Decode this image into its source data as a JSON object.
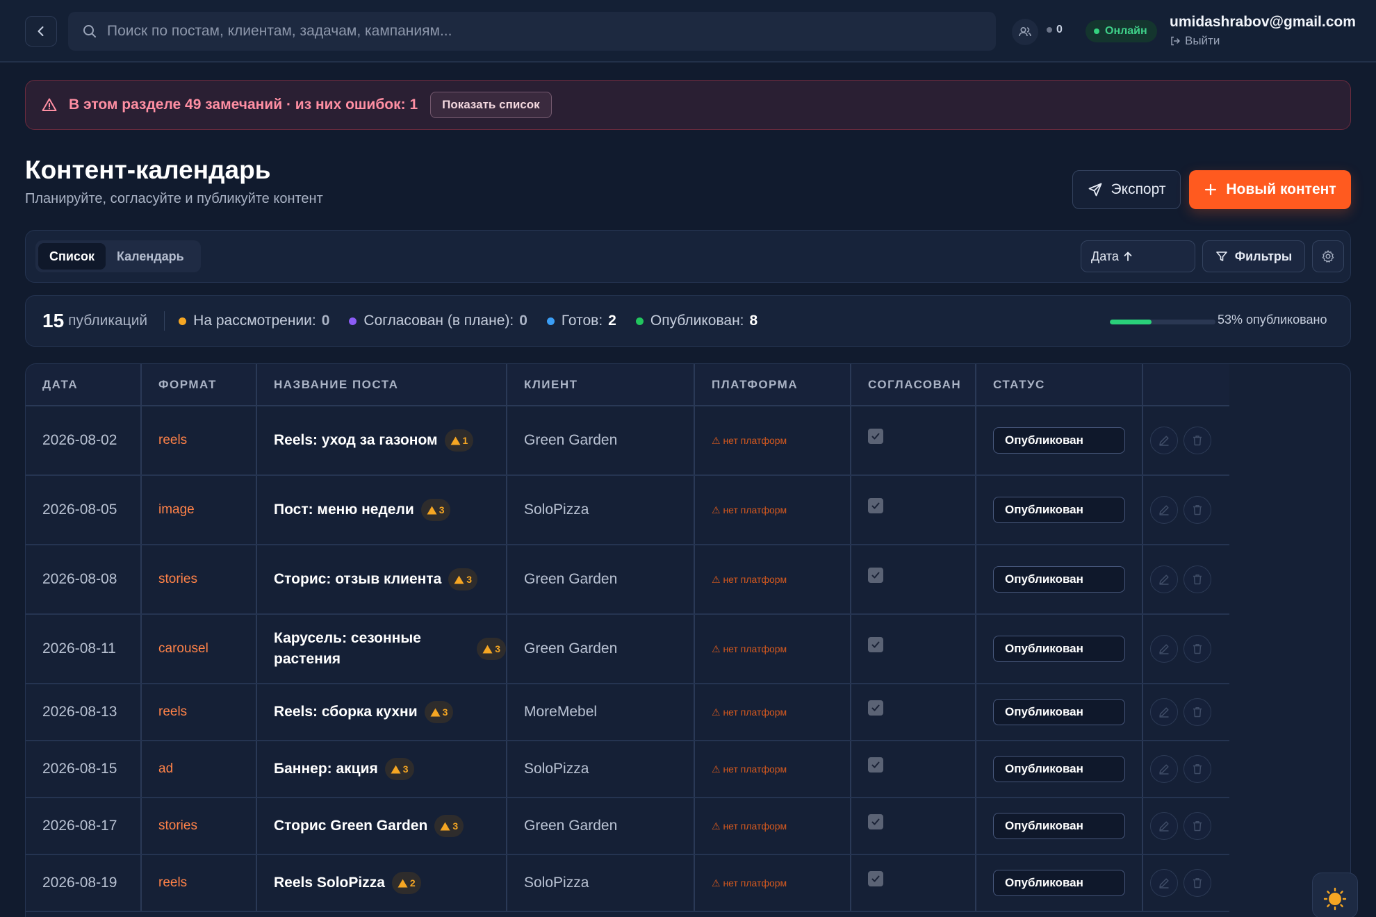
{
  "header": {
    "search_placeholder": "Поиск по постам, клиентам, задачам, кампаниям...",
    "online_users_count": "0",
    "online_label": "Онлайн",
    "user_email": "umidashrabov@gmail.com",
    "logout_label": "Выйти"
  },
  "alert": {
    "text": "В этом разделе 49 замечаний · из них ошибок: 1",
    "button_label": "Показать список"
  },
  "page": {
    "title": "Контент-календарь",
    "subtitle": "Планируйте, согласуйте и публикуйте контент",
    "export_label": "Экспорт",
    "new_content_label": "Новый контент"
  },
  "toolbar": {
    "tab_list": "Список",
    "tab_calendar": "Календарь",
    "sort_label": "Дата",
    "filters_label": "Фильтры"
  },
  "stats": {
    "total": "15",
    "total_label": "публикаций",
    "items": [
      {
        "label": "На рассмотрении:",
        "value": "0",
        "color": "#f5a623"
      },
      {
        "label": "Согласован (в плане):",
        "value": "0",
        "color": "#8b5cf6"
      },
      {
        "label": "Готов:",
        "value": "2",
        "color": "#3b9ef5"
      },
      {
        "label": "Опубликован:",
        "value": "8",
        "color": "#22c55e"
      }
    ],
    "published_percent": 53,
    "published_label": "53% опубликовано"
  },
  "table": {
    "headers": [
      "ДАТА",
      "ФОРМАТ",
      "НАЗВАНИЕ ПОСТА",
      "КЛИЕНТ",
      "ПЛАТФОРМА",
      "СОГЛАСОВАН",
      "СТАТУС",
      ""
    ],
    "rows": [
      {
        "date": "2026-08-02",
        "format": "reels",
        "title": "Reels: уход за газоном",
        "warnings": "1",
        "client": "Green Garden",
        "platform": "нет платформ",
        "approved": true,
        "status": "Опубликован"
      },
      {
        "date": "2026-08-05",
        "format": "image",
        "title": "Пост: меню недели",
        "warnings": "3",
        "client": "SoloPizza",
        "platform": "нет платформ",
        "approved": true,
        "status": "Опубликован"
      },
      {
        "date": "2026-08-08",
        "format": "stories",
        "title": "Сторис: отзыв клиента",
        "warnings": "3",
        "client": "Green Garden",
        "platform": "нет платформ",
        "approved": true,
        "status": "Опубликован"
      },
      {
        "date": "2026-08-11",
        "format": "carousel",
        "title": "Карусель: сезонные растения",
        "warnings": "3",
        "client": "Green Garden",
        "platform": "нет платформ",
        "approved": true,
        "status": "Опубликован"
      },
      {
        "date": "2026-08-13",
        "format": "reels",
        "title": "Reels: сборка кухни",
        "warnings": "3",
        "client": "MoreMebel",
        "platform": "нет платформ",
        "approved": true,
        "status": "Опубликован"
      },
      {
        "date": "2026-08-15",
        "format": "ad",
        "title": "Баннер: акция",
        "warnings": "3",
        "client": "SoloPizza",
        "platform": "нет платформ",
        "approved": true,
        "status": "Опубликован"
      },
      {
        "date": "2026-08-17",
        "format": "stories",
        "title": "Сторис Green Garden",
        "warnings": "3",
        "client": "Green Garden",
        "platform": "нет платформ",
        "approved": true,
        "status": "Опубликован"
      },
      {
        "date": "2026-08-19",
        "format": "reels",
        "title": "Reels SoloPizza",
        "warnings": "2",
        "client": "SoloPizza",
        "platform": "нет платформ",
        "approved": true,
        "status": "Опубликован"
      }
    ]
  },
  "icons": {
    "back": "chevron-left-icon",
    "search": "search-icon",
    "users": "users-icon",
    "logout": "logout-icon",
    "alert": "warning-triangle-icon",
    "export": "send-icon",
    "plus": "plus-icon",
    "sort": "arrow-up-icon",
    "filter": "filter-icon",
    "settings": "gear-icon",
    "edit": "pencil-icon",
    "delete": "trash-icon",
    "theme": "sun-icon"
  }
}
